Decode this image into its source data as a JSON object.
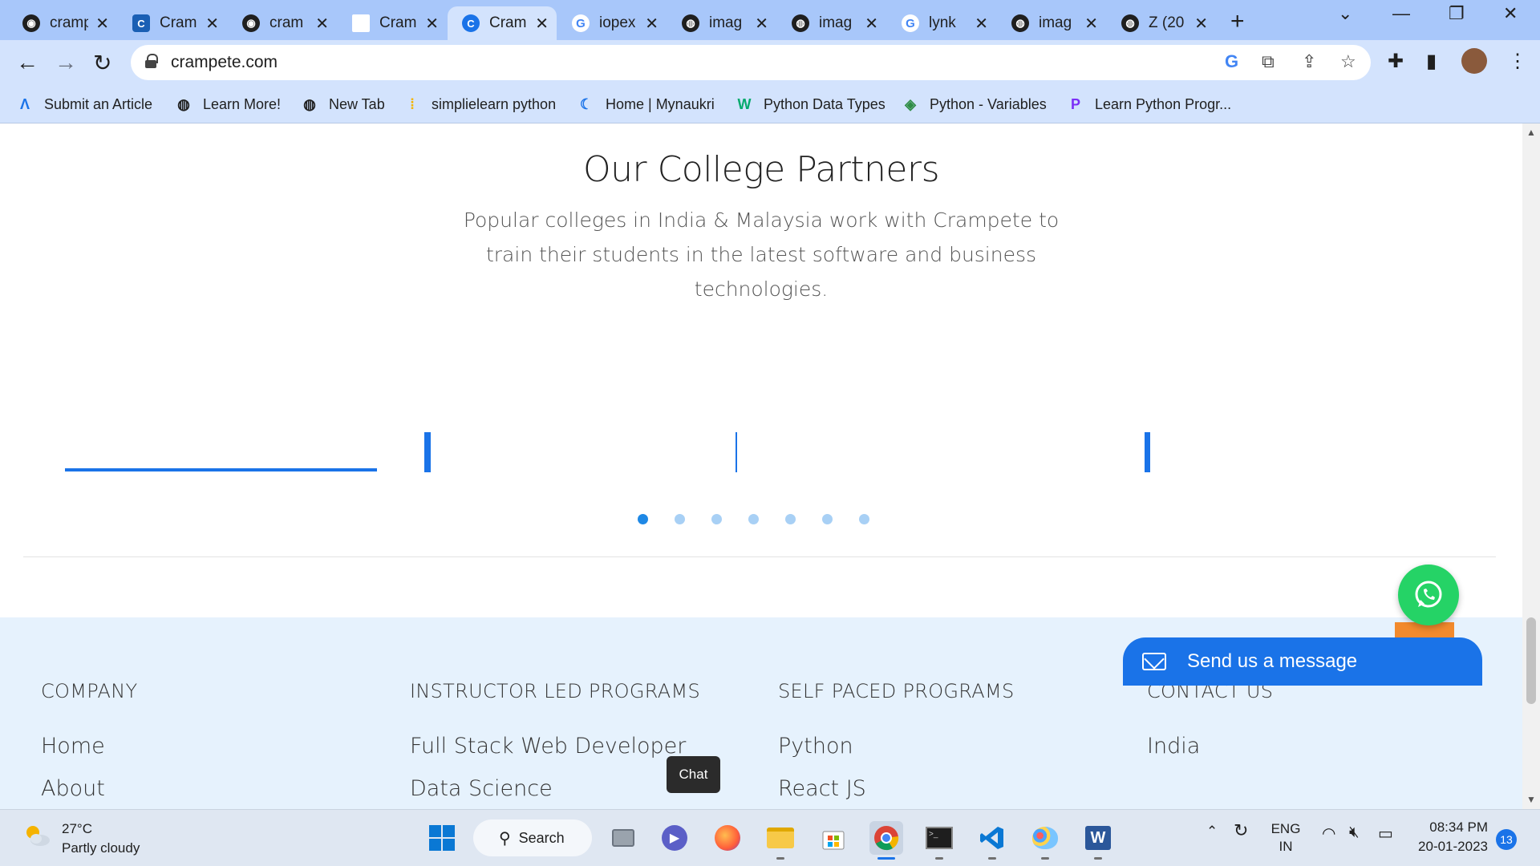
{
  "browser": {
    "tabs": [
      {
        "title": "cramp",
        "icon": "github-icon"
      },
      {
        "title": "Cram",
        "icon": "crampete-icon"
      },
      {
        "title": "cram",
        "icon": "github-icon"
      },
      {
        "title": "Cram",
        "icon": "blank-page-icon"
      },
      {
        "title": "Cram",
        "icon": "crampete-icon"
      },
      {
        "title": "iopex",
        "icon": "google-icon"
      },
      {
        "title": "imag",
        "icon": "globe-icon"
      },
      {
        "title": "imag",
        "icon": "globe-icon"
      },
      {
        "title": "lynk",
        "icon": "google-icon"
      },
      {
        "title": "imag",
        "icon": "globe-icon"
      },
      {
        "title": "Z (20",
        "icon": "globe-icon"
      }
    ],
    "active_tab_index": 4,
    "url": "crampete.com",
    "bookmarks": [
      {
        "label": "Submit an Article",
        "icon": "aws-icon"
      },
      {
        "label": "Learn More!",
        "icon": "globe-icon"
      },
      {
        "label": "New Tab",
        "icon": "globe-icon"
      },
      {
        "label": "simplielearn python",
        "icon": "simplilearn-icon"
      },
      {
        "label": "Home | Mynaukri",
        "icon": "mynaukri-icon"
      },
      {
        "label": "Python Data Types",
        "icon": "w3schools-icon"
      },
      {
        "label": "Python - Variables",
        "icon": "tutorialspoint-icon"
      },
      {
        "label": "Learn Python Progr...",
        "icon": "programiz-icon"
      }
    ]
  },
  "page": {
    "partners": {
      "title": "Our College Partners",
      "description": "Popular colleges in India & Malaysia work with Crampete to train their students in the latest software and business technologies.",
      "carousel_dots": 7,
      "active_dot": 0
    },
    "footer": {
      "columns": [
        {
          "heading": "COMPANY",
          "links": [
            "Home",
            "About"
          ]
        },
        {
          "heading": "INSTRUCTOR LED PROGRAMS",
          "links": [
            "Full Stack Web Developer",
            "Data Science"
          ]
        },
        {
          "heading": "SELF PACED PROGRAMS",
          "links": [
            "Python",
            "React JS"
          ]
        },
        {
          "heading": "CONTACT US",
          "links": [
            "India"
          ]
        }
      ]
    },
    "chat_tooltip": "Chat",
    "message_bar": "Send us a message"
  },
  "taskbar": {
    "weather_temp": "27°C",
    "weather_desc": "Partly cloudy",
    "search_label": "Search",
    "language_line1": "ENG",
    "language_line2": "IN",
    "time": "08:34 PM",
    "date": "20-01-2023",
    "notification_count": "13"
  },
  "colors": {
    "accent": "#1a73e8",
    "footer_bg": "#e6f2fd",
    "whatsapp": "#25d366",
    "tabstrip": "#a8c7fa"
  }
}
